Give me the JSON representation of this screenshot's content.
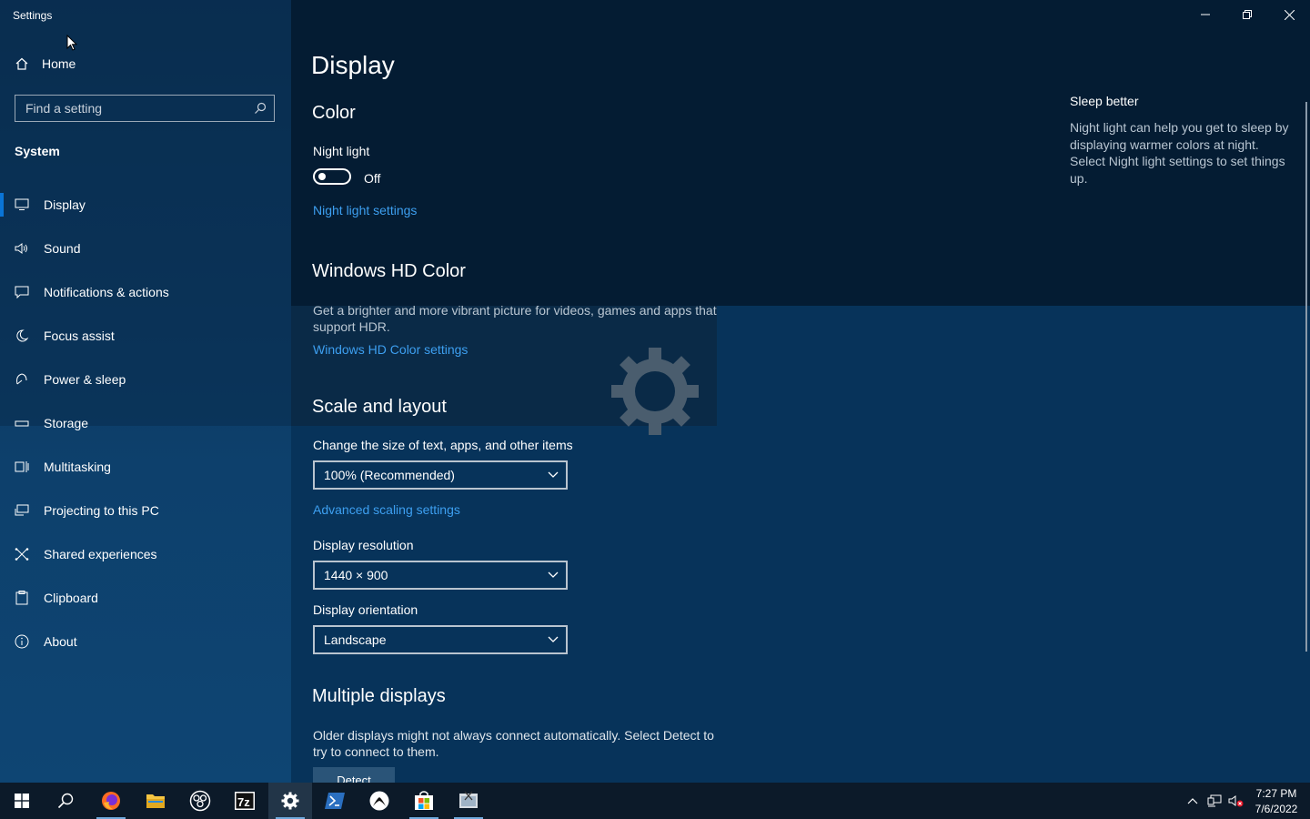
{
  "window": {
    "title": "Settings",
    "controls": {
      "minimize": "—",
      "restore": "❐",
      "close": "✕"
    }
  },
  "sidebar": {
    "home_label": "Home",
    "search_placeholder": "Find a setting",
    "section": "System",
    "items": [
      {
        "label": "Display",
        "icon": "monitor-icon",
        "glyph": "🖵"
      },
      {
        "label": "Sound",
        "icon": "speaker-icon",
        "glyph": "🔈"
      },
      {
        "label": "Notifications & actions",
        "icon": "message-icon",
        "glyph": "🗨"
      },
      {
        "label": "Focus assist",
        "icon": "moon-icon",
        "glyph": "☾"
      },
      {
        "label": "Power & sleep",
        "icon": "power-icon",
        "glyph": "⏻"
      },
      {
        "label": "Storage",
        "icon": "drive-icon",
        "glyph": "▭"
      },
      {
        "label": "Multitasking",
        "icon": "multitask-icon",
        "glyph": "⧉"
      },
      {
        "label": "Projecting to this PC",
        "icon": "project-icon",
        "glyph": "⎚"
      },
      {
        "label": "Shared experiences",
        "icon": "shared-icon",
        "glyph": "✕"
      },
      {
        "label": "Clipboard",
        "icon": "clipboard-icon",
        "glyph": "📋"
      },
      {
        "label": "About",
        "icon": "info-icon",
        "glyph": "ⓘ"
      }
    ],
    "selected": "Display"
  },
  "main": {
    "page_title": "Display",
    "color": {
      "heading": "Color",
      "night_light_label": "Night light",
      "toggle_state": "Off",
      "night_light_link": "Night light settings"
    },
    "hd": {
      "heading": "Windows HD Color",
      "desc_line1": "Get a brighter and more vibrant picture for videos, games and apps that",
      "desc_line2": "support HDR.",
      "link": "Windows HD Color settings"
    },
    "scale": {
      "heading": "Scale and layout",
      "size_label": "Change the size of text, apps, and other items",
      "size_value": "100% (Recommended)",
      "advanced_link": "Advanced scaling settings",
      "resolution_label": "Display resolution",
      "resolution_value": "1440 × 900",
      "orientation_label": "Display orientation",
      "orientation_value": "Landscape"
    },
    "multiple": {
      "heading": "Multiple displays",
      "desc_line1": "Older displays might not always connect automatically. Select Detect to",
      "desc_line2": "try to connect to them.",
      "detect_button": "Detect"
    }
  },
  "side_panel": {
    "title": "Sleep better",
    "desc": "Night light can help you get to sleep by displaying warmer colors at night. Select Night light settings to set things up."
  },
  "taskbar": {
    "apps": [
      "start",
      "search",
      "firefox",
      "file-explorer",
      "obs",
      "7zip",
      "settings",
      "powershell",
      "xbox",
      "store",
      "snipping"
    ],
    "active_app": "settings",
    "clock": {
      "time": "7:27 PM",
      "date": "7/6/2022"
    }
  },
  "colors": {
    "accent": "#0a74d6",
    "link": "#3d9ff0"
  }
}
